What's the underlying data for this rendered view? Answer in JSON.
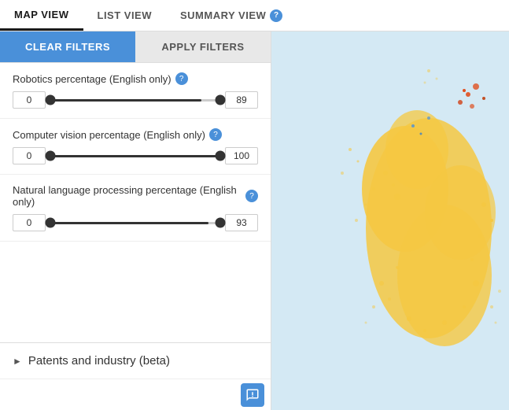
{
  "tabs": [
    {
      "id": "map-view",
      "label": "MAP VIEW",
      "active": true
    },
    {
      "id": "list-view",
      "label": "LIST VIEW",
      "active": false
    },
    {
      "id": "summary-view",
      "label": "SUMMARY VIEW",
      "active": false,
      "hasHelp": true
    }
  ],
  "filters": {
    "clear_label": "CLEAR FILTERS",
    "apply_label": "APPLY FILTERS",
    "sections": [
      {
        "id": "robotics",
        "label": "Robotics percentage (English only)",
        "hasInfo": true,
        "min": 0,
        "max": 89,
        "minDisplay": "0",
        "maxDisplay": "89",
        "fillPct": 89,
        "leftPct": 0
      },
      {
        "id": "computer-vision",
        "label": "Computer vision percentage (English only)",
        "hasInfo": true,
        "min": 0,
        "max": 100,
        "minDisplay": "0",
        "maxDisplay": "100",
        "fillPct": 100,
        "leftPct": 0
      },
      {
        "id": "nlp",
        "label": "Natural language processing percentage (English only)",
        "hasInfo": true,
        "min": 0,
        "max": 93,
        "minDisplay": "0",
        "maxDisplay": "93",
        "fillPct": 93,
        "leftPct": 0
      }
    ]
  },
  "patents_section": {
    "label": "Patents and industry (beta)"
  },
  "notification": {
    "aria_label": "Notification"
  }
}
